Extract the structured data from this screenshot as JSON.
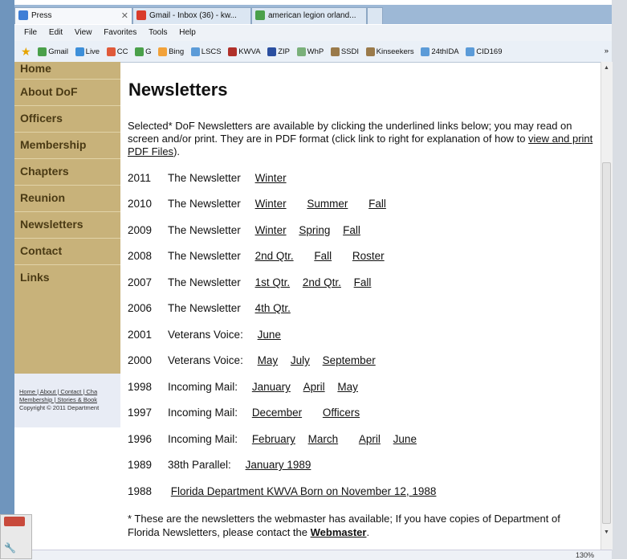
{
  "browser": {
    "tabs": [
      {
        "label": "Press",
        "active": true
      },
      {
        "label": "Gmail - Inbox (36) - kw...",
        "active": false
      },
      {
        "label": "american legion orland...",
        "active": false
      }
    ],
    "tab_close": "✕",
    "menu": [
      "File",
      "Edit",
      "View",
      "Favorites",
      "Tools",
      "Help"
    ],
    "favorites": [
      "Gmail",
      "Live",
      "CC",
      "G",
      "Bing",
      "LSCS",
      "KWVA",
      "ZIP",
      "WhP",
      "SSDI",
      "Kinseekers",
      "24thIDA",
      "CID169"
    ],
    "favorites_overflow": "»",
    "zoom": "130%"
  },
  "sidebar": {
    "items": [
      "Home",
      "About DoF",
      "Officers",
      "Membership",
      "Chapters",
      "Reunion",
      "Newsletters",
      "Contact",
      "Links"
    ],
    "footer_links": "Home | About | Contact | Cha",
    "footer_links2": "Membership | Stories & Book",
    "copyright": "Copyright © 2011 Department"
  },
  "page": {
    "title": "Newsletters",
    "intro_text": "Selected* DoF Newsletters are available by clicking the underlined links below; you may read on screen and/or print. They are in PDF format (click link to right for explanation of how to ",
    "intro_link": "view and print PDF Files",
    "intro_end": ").",
    "rows": [
      {
        "year": "2011",
        "label": "The Newsletter",
        "links": [
          "Winter"
        ]
      },
      {
        "year": "2010",
        "label": "The Newsletter",
        "links": [
          "Winter",
          "Summer",
          "Fall"
        ]
      },
      {
        "year": "2009",
        "label": "The Newsletter",
        "links": [
          "Winter",
          "Spring",
          "Fall"
        ]
      },
      {
        "year": "2008",
        "label": "The Newsletter",
        "links": [
          "2nd Qtr.",
          "Fall",
          "Roster"
        ]
      },
      {
        "year": "2007",
        "label": "The Newsletter",
        "links": [
          "1st Qtr.",
          "2nd Qtr.",
          "Fall"
        ]
      },
      {
        "year": "2006",
        "label": "The Newsletter",
        "links": [
          "4th Qtr."
        ]
      },
      {
        "year": "2001",
        "label": "Veterans Voice:",
        "links": [
          "June"
        ]
      },
      {
        "year": "2000",
        "label": "Veterans Voice:",
        "links": [
          "May",
          "July",
          "September"
        ]
      },
      {
        "year": "1998",
        "label": "Incoming Mail:",
        "links": [
          "January",
          "April",
          "May"
        ]
      },
      {
        "year": "1997",
        "label": "Incoming Mail:",
        "links": [
          "December",
          "Officers"
        ]
      },
      {
        "year": "1996",
        "label": "Incoming Mail:",
        "links": [
          "February",
          "March",
          "April",
          "June"
        ]
      },
      {
        "year": "1989",
        "label": "38th Parallel:",
        "links": [
          "January 1989"
        ]
      },
      {
        "year": "1988",
        "label": "",
        "links": [
          "Florida Department KWVA Born on November 12, 1988"
        ]
      }
    ],
    "note_text": "* These are the newsletters the webmaster has available; If you have copies of Department of Florida Newsletters, please contact the ",
    "note_link": "Webmaster",
    "note_end": "."
  }
}
